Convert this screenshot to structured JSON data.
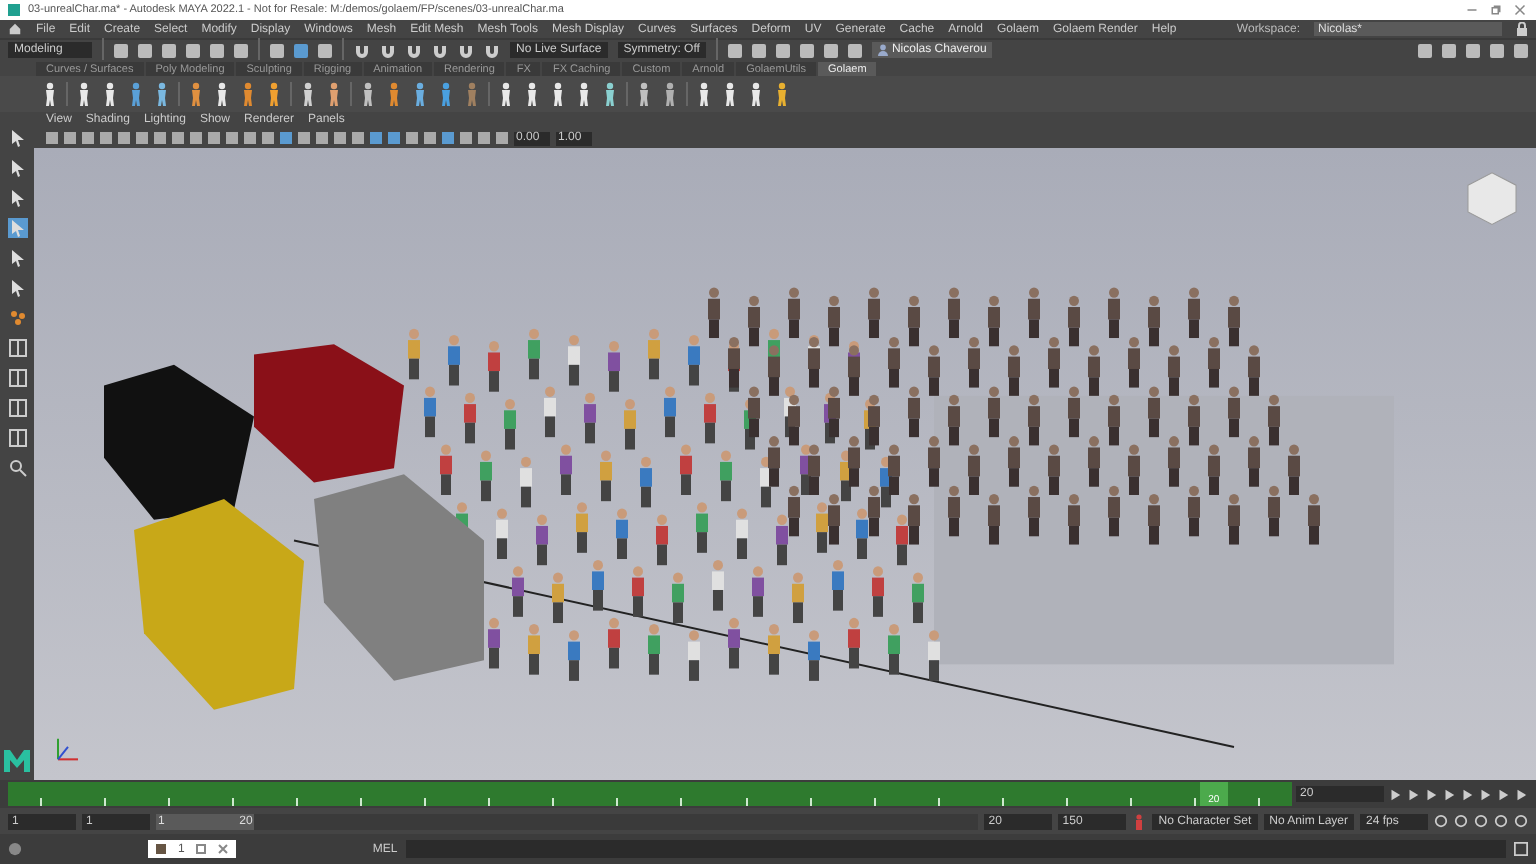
{
  "window": {
    "title": "03-unrealChar.ma* - Autodesk MAYA 2022.1 - Not for Resale: M:/demos/golaem/FP/scenes/03-unrealChar.ma"
  },
  "menu_bar": {
    "items": [
      "File",
      "Edit",
      "Create",
      "Select",
      "Modify",
      "Display",
      "Windows",
      "Mesh",
      "Edit Mesh",
      "Mesh Tools",
      "Mesh Display",
      "Curves",
      "Surfaces",
      "Deform",
      "UV",
      "Generate",
      "Cache",
      "Arnold",
      "Golaem",
      "Golaem Render",
      "Help"
    ]
  },
  "workspace": {
    "label": "Workspace:",
    "value": "Nicolas*"
  },
  "status_line": {
    "mode": "Modeling",
    "live_surface": "No Live Surface",
    "symmetry": "Symmetry: Off",
    "user": "Nicolas Chaverou"
  },
  "shelf": {
    "tabs": [
      {
        "label": "Curves / Surfaces",
        "selected": false
      },
      {
        "label": "Poly Modeling",
        "selected": false
      },
      {
        "label": "Sculpting",
        "selected": false
      },
      {
        "label": "Rigging",
        "selected": false
      },
      {
        "label": "Animation",
        "selected": false
      },
      {
        "label": "Rendering",
        "selected": false
      },
      {
        "label": "FX",
        "selected": false
      },
      {
        "label": "FX Caching",
        "selected": false
      },
      {
        "label": "Custom",
        "selected": false
      },
      {
        "label": "Arnold",
        "selected": false
      },
      {
        "label": "GolaemUtils",
        "selected": false
      },
      {
        "label": "Golaem",
        "selected": true
      }
    ]
  },
  "viewport": {
    "menu": [
      "View",
      "Shading",
      "Lighting",
      "Show",
      "Renderer",
      "Panels"
    ],
    "fields": [
      "0.00",
      "1.00"
    ]
  },
  "time_slider": {
    "current_frame": "20",
    "current_frame_field": "20",
    "level": 0.95
  },
  "range_slider": {
    "start": "1",
    "playback_start": "1",
    "handle_start": "1",
    "handle_end": "20",
    "level": 0.12,
    "playback_end": "20",
    "end": "150",
    "character_set": "No Character Set",
    "anim_layer": "No Anim Layer",
    "fps": "24 fps"
  },
  "command_line": {
    "language": "MEL"
  },
  "floating_window": {
    "label": "1"
  }
}
